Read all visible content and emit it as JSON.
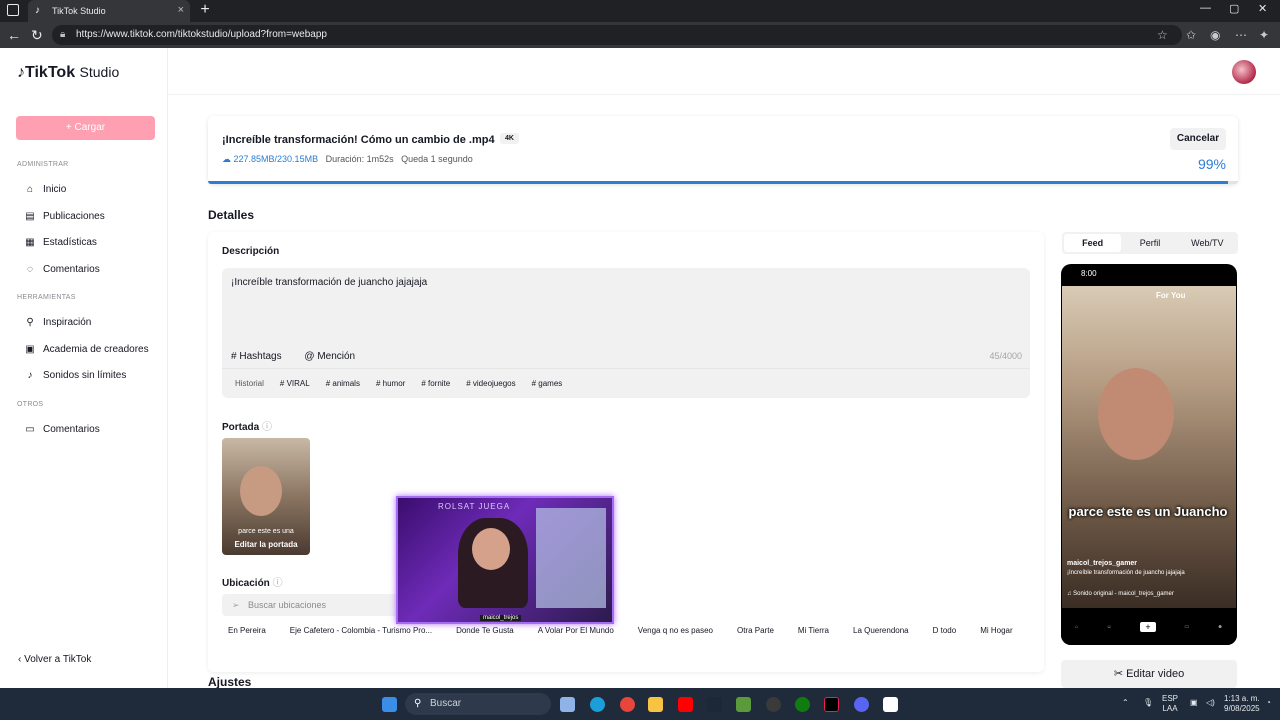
{
  "browser": {
    "tab_title": "TikTok Studio",
    "tab_close": "×",
    "new_tab": "+",
    "url": "https://www.tiktok.com/tiktokstudio/upload?from=webapp"
  },
  "sidebar": {
    "logo_text": "TikTok",
    "logo_suffix": "Studio",
    "upload_label": "+ Cargar",
    "sections": {
      "admin": "ADMINISTRAR",
      "tools": "HERRAMIENTAS",
      "others": "OTROS"
    },
    "items": [
      {
        "label": "Inicio",
        "icon": "home-icon"
      },
      {
        "label": "Publicaciones",
        "icon": "posts-icon"
      },
      {
        "label": "Estadísticas",
        "icon": "stats-icon"
      },
      {
        "label": "Comentarios",
        "icon": "comments-icon"
      },
      {
        "label": "Inspiración",
        "icon": "bulb-icon"
      },
      {
        "label": "Academia de creadores",
        "icon": "academy-icon"
      },
      {
        "label": "Sonidos sin límites",
        "icon": "music-icon"
      },
      {
        "label": "Comentarios",
        "icon": "comments-icon"
      }
    ],
    "back_label": "Volver a TikTok"
  },
  "upload": {
    "filename": "¡Increíble transformación! Cómo un cambio de .mp4",
    "badge": "4K",
    "size": "227.85MB/230.15MB",
    "duration": "Duración: 1m52s",
    "remaining": "Queda 1 segundo",
    "cancel_label": "Cancelar",
    "percent_label": "99%",
    "progress": 0.99
  },
  "details": {
    "title": "Detalles",
    "description_label": "Descripción",
    "description_value": "¡Increíble transformación de juancho jajajaja",
    "hashtags_label": "Hashtags",
    "mention_label": "Mención",
    "counter": "45/4000",
    "history_label": "Historial",
    "chips": [
      "# VIRAL",
      "# animals",
      "# humor",
      "# fornite",
      "# videojuegos",
      "# games"
    ],
    "cover_label": "Portada",
    "cover_caption": "parce  este es una",
    "cover_edit": "Editar la portada",
    "location_label": "Ubicación",
    "location_placeholder": "Buscar ubicaciones",
    "locations": [
      "En Pereira",
      "Eje Cafetero - Colombia - Turismo Pro...",
      "Donde Te Gusta",
      "A Volar Por El Mundo",
      "Venga q no es paseo",
      "Otra Parte",
      "Mi Tierra",
      "La Querendona",
      "D todo",
      "Mi Hogar"
    ],
    "settings_title": "Ajustes"
  },
  "overlay": {
    "banner": "ROLSAT JUEGA",
    "name_tag": "maicol_trejos"
  },
  "preview": {
    "tabs": [
      "Feed",
      "Perfil",
      "Web/TV"
    ],
    "active_tab": "Feed",
    "time": "8:00",
    "for_you": "For You",
    "caption": "parce  este es un Juancho",
    "username": "maicol_trejos_gamer",
    "desc": "¡Increíble transformación de juancho jajajaja",
    "sound": "Sonido original - maicol_trejos_gamer",
    "edit_label": "Editar video"
  },
  "taskbar": {
    "search_label": "Buscar",
    "lang": "ESP",
    "layout": "LAA",
    "time": "1:13 a. m.",
    "date": "9/08/2025"
  }
}
